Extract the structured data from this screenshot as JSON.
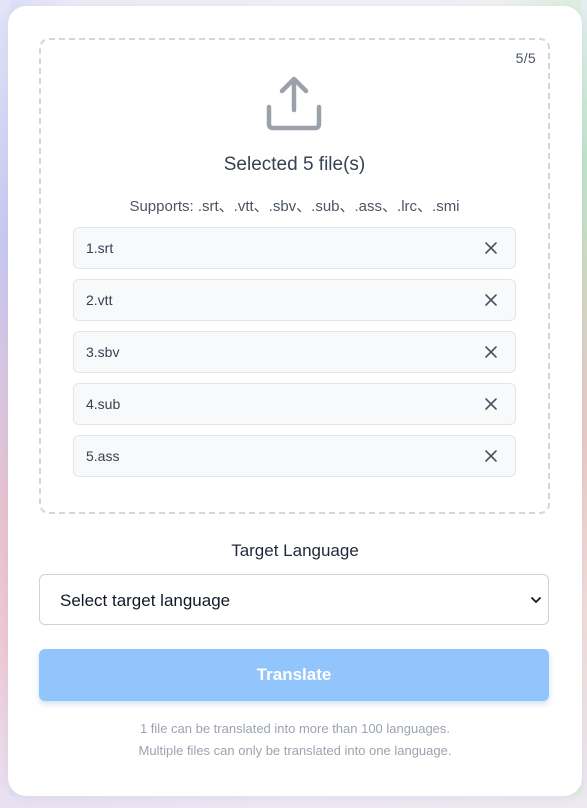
{
  "upload": {
    "count": "5/5",
    "icon": "upload-icon",
    "title": "Selected 5 file(s)",
    "supports": "Supports: .srt、.vtt、.sbv、.sub、.ass、.lrc、.smi",
    "files": [
      {
        "name": "1.srt"
      },
      {
        "name": "2.vtt"
      },
      {
        "name": "3.sbv"
      },
      {
        "name": "4.sub"
      },
      {
        "name": "5.ass"
      }
    ]
  },
  "language": {
    "label": "Target Language",
    "select_value": "Select target language"
  },
  "actions": {
    "translate_label": "Translate",
    "translate_color": "#93c5fd"
  },
  "notes": {
    "line1": "1 file can be translated into more than 100 languages.",
    "line2": "Multiple files can only be translated into one language."
  }
}
